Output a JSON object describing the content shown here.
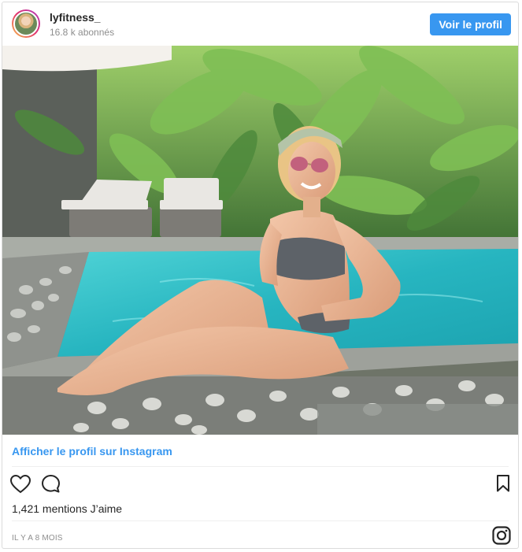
{
  "header": {
    "username": "lyfitness_",
    "followers": "16.8 k abonnés",
    "view_profile_button": "Voir le profil"
  },
  "post": {
    "profile_link": "Afficher le profil sur Instagram",
    "likes": "1,421 mentions J’aime",
    "time": "IL Y A 8 MOIS"
  },
  "icons": {
    "like": "heart-icon",
    "comment": "comment-icon",
    "save": "bookmark-icon",
    "brand": "instagram-icon"
  },
  "colors": {
    "accent": "#3897f0",
    "text": "#262626",
    "muted": "#8e8e8e",
    "border": "#dbdbdb"
  }
}
